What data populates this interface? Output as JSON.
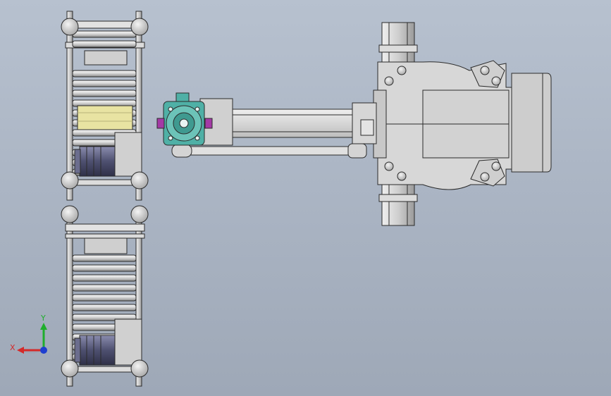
{
  "viewport": {
    "background_top": "#b7c1cf",
    "background_bottom": "#9ea8b7"
  },
  "triad": {
    "x_label": "X",
    "y_label": "Y",
    "x_color": "#d42a2a",
    "y_color": "#1fae2c",
    "z_color": "#1e3fd0"
  },
  "colors": {
    "outline": "#2b2b2b",
    "metal_light": "#e6e6e6",
    "metal_mid": "#c9c9c9",
    "metal_dark": "#8e8e8e",
    "motor_body": "#5a5c7a",
    "plate_yellow": "#e8e3a2",
    "gripper_teal": "#4fb0a6",
    "clamp_purple": "#a43aa6"
  },
  "scene": {
    "objects": [
      {
        "name": "upper-roller-conveyor",
        "icon": "conveyor-icon"
      },
      {
        "name": "lower-roller-conveyor",
        "icon": "conveyor-icon"
      },
      {
        "name": "upper-conveyor-drive-motor",
        "icon": "motor-icon"
      },
      {
        "name": "lower-conveyor-drive-motor",
        "icon": "motor-icon"
      },
      {
        "name": "workpiece-plate",
        "icon": "plate-icon"
      },
      {
        "name": "robot-base",
        "icon": "robot-base-icon"
      },
      {
        "name": "robot-upper-arm",
        "icon": "arm-icon"
      },
      {
        "name": "robot-link-rod",
        "icon": "rod-icon"
      },
      {
        "name": "end-effector-gripper",
        "icon": "gripper-icon"
      }
    ]
  }
}
